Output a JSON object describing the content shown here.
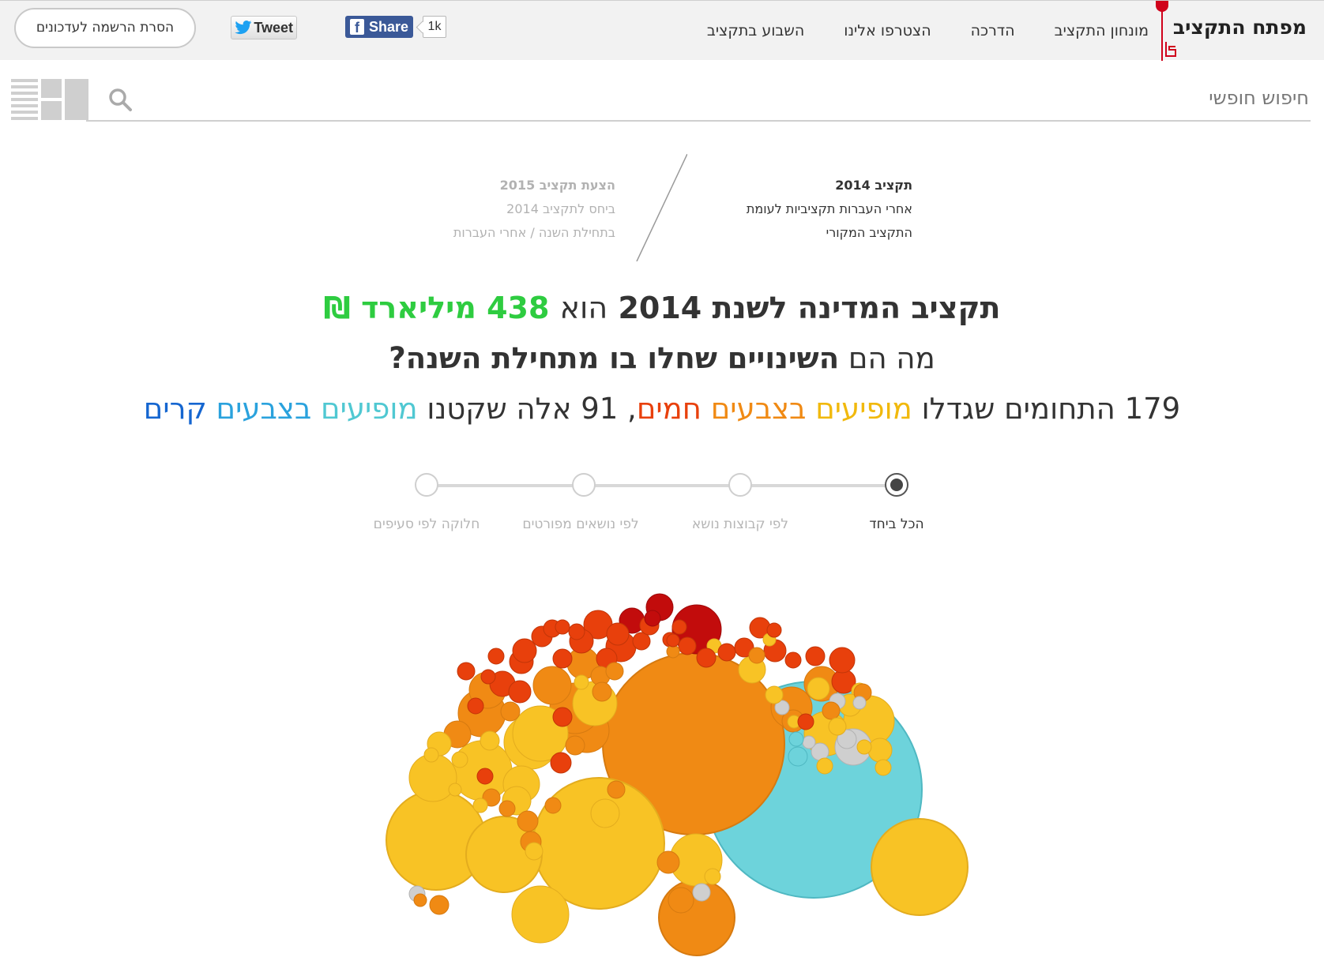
{
  "nav": {
    "brand": "מפתח התקציב",
    "items": [
      "מונחון התקציב",
      "הדרכה",
      "הצטרפו אלינו",
      "השבוע בתקציב"
    ]
  },
  "social": {
    "share_label": "Share",
    "share_count": "1k",
    "tweet_label": "Tweet"
  },
  "unsubscribe_label": "הסרת הרשמה לעדכונים",
  "search": {
    "placeholder": "חיפוש חופשי"
  },
  "budget_switch": {
    "current": {
      "title": "תקציב 2014",
      "line1": "אחרי העברות תקציביות לעומת",
      "line2": "התקציב המקורי"
    },
    "other": {
      "title": "הצעת תקציב 2015",
      "line1": "ביחס לתקציב 2014",
      "line2": "בתחילת השנה / אחרי העברות"
    }
  },
  "headline": {
    "line1_a": "תקציב המדינה לשנת 2014",
    "line1_b": "הוא",
    "line1_amount": "438 מיליארד ₪",
    "line2_a": "מה הם",
    "line2_b": "השינויים שחלו בו מתחילת השנה?",
    "line3": {
      "p1": "179 התחומים שגדלו",
      "w1": "מופיעים",
      "w2": "בצבעים",
      "w3": "חמים",
      "p2": ", 91 אלה שקטנו",
      "w4": "מופיעים",
      "w5": "בצבעים",
      "w6": "קרים"
    }
  },
  "steps": [
    {
      "label": "הכל ביחד",
      "active": true
    },
    {
      "label": "לפי קבוצות נושא",
      "active": false
    },
    {
      "label": "לפי נושאים מפורטים",
      "active": false
    },
    {
      "label": "חלוקה לפי סעיפים",
      "active": false
    }
  ],
  "colors": {
    "brand_red": "#d0021b",
    "increase_small": "#f8c325",
    "increase_mid": "#f08a14",
    "increase_large": "#e8400c",
    "increase_max": "#c20c0c",
    "decrease": "#6dd3db",
    "neutral": "#cfcfcf"
  }
}
